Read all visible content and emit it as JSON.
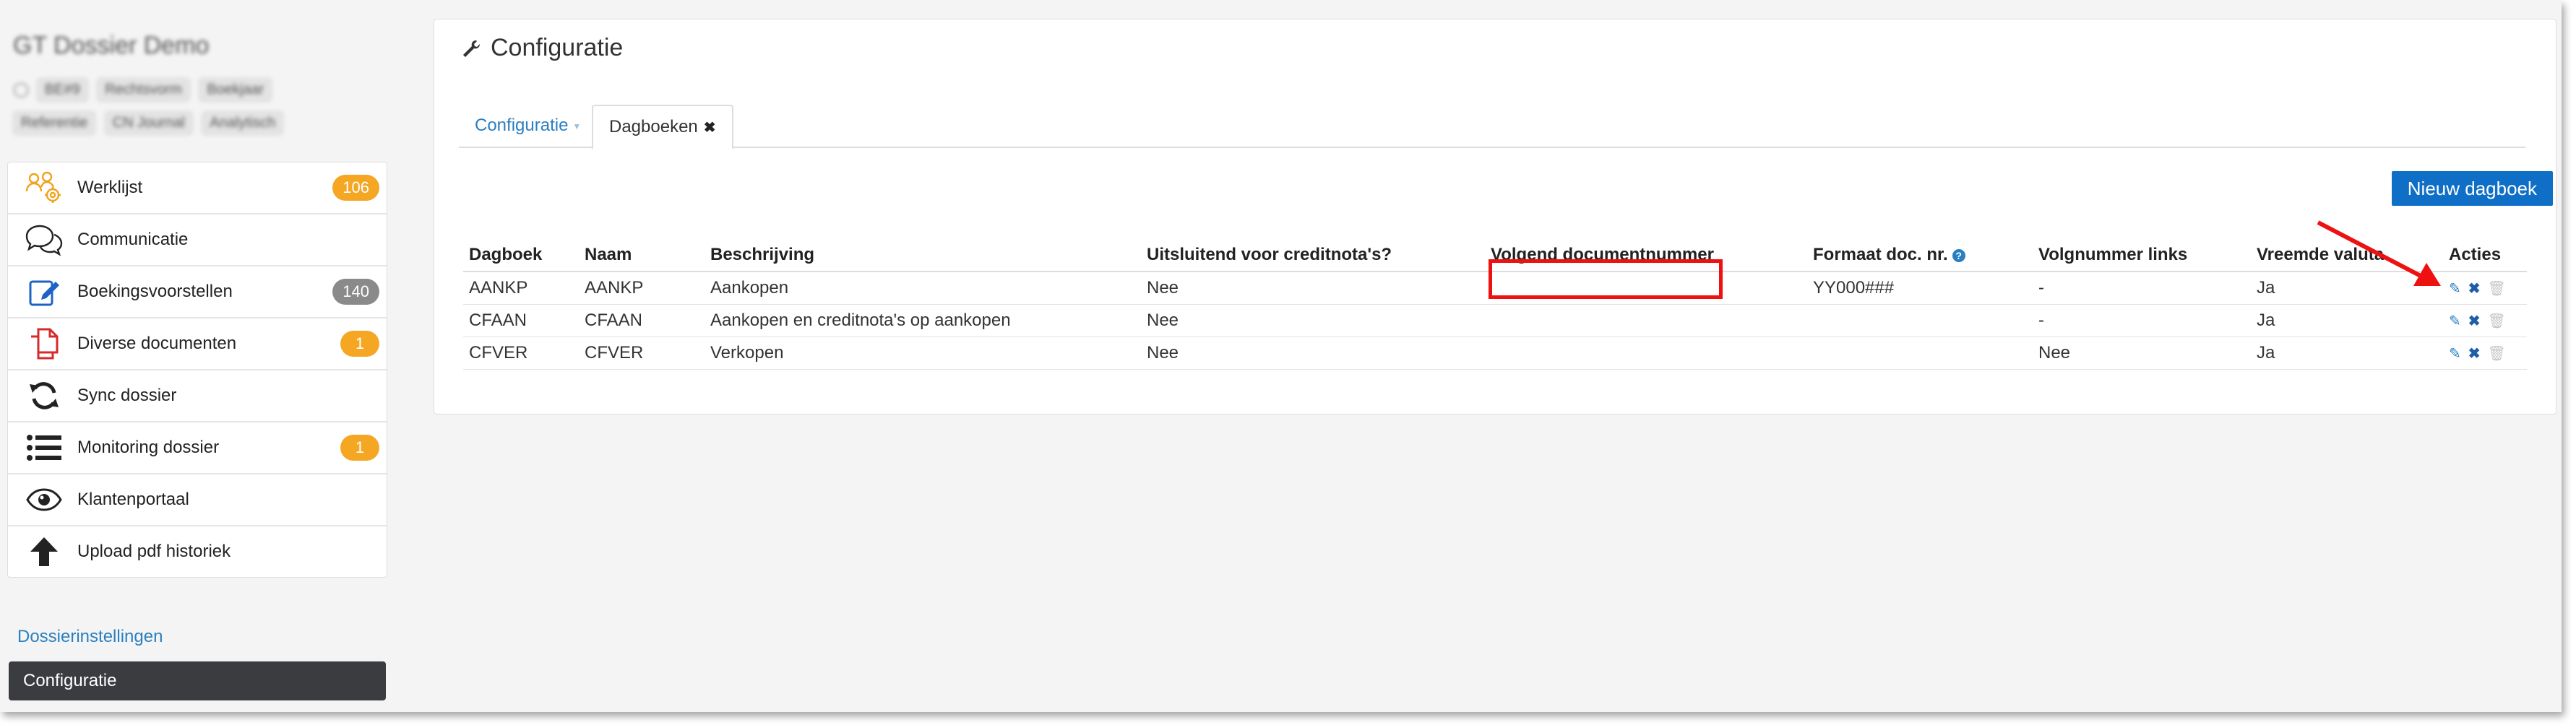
{
  "sidebar": {
    "dossier_title": "GT Dossier Demo",
    "tags_row1": [
      "BE#9",
      "Rechtsvorm",
      "Boekjaar"
    ],
    "tags_row2": [
      "Referentie",
      "CN Journal",
      "Analytisch"
    ],
    "menu": [
      {
        "label": "Werklijst",
        "icon": "users-cog-icon",
        "badge": "106",
        "badge_color": "#f5a623"
      },
      {
        "label": "Communicatie",
        "icon": "chat-bubbles-icon",
        "badge": null
      },
      {
        "label": "Boekingsvoorstellen",
        "icon": "edit-square-icon",
        "badge": "140",
        "badge_color": "#8a8a8a"
      },
      {
        "label": "Diverse documenten",
        "icon": "documents-icon",
        "badge": "1",
        "badge_color": "#f5a623"
      },
      {
        "label": "Sync dossier",
        "icon": "sync-icon",
        "badge": null
      },
      {
        "label": "Monitoring dossier",
        "icon": "list-icon",
        "badge": "1",
        "badge_color": "#f5a623"
      },
      {
        "label": "Klantenportaal",
        "icon": "eye-icon",
        "badge": null
      },
      {
        "label": "Upload pdf historiek",
        "icon": "arrow-up-icon",
        "badge": null
      }
    ],
    "settings_link": "Dossierinstellingen",
    "active_item": "Configuratie"
  },
  "panel": {
    "title": "Configuratie",
    "tabs": [
      {
        "label": "Configuratie"
      },
      {
        "label": "Dagboeken"
      }
    ],
    "new_button": "Nieuw dagboek",
    "columns": [
      "Dagboek",
      "Naam",
      "Beschrijving",
      "Uitsluitend voor creditnota's?",
      "Volgend documentnummer",
      "Formaat doc. nr.",
      "Volgnummer links",
      "Vreemde valuta",
      "Acties"
    ],
    "rows": [
      [
        "AANKP",
        "AANKP",
        "Aankopen",
        "Nee",
        "",
        "YY000###",
        "-",
        "Ja"
      ],
      [
        "CFAAN",
        "CFAAN",
        "Aankopen en creditnota's op aankopen",
        "Nee",
        "",
        "",
        "-",
        "Ja"
      ],
      [
        "CFVER",
        "CFVER",
        "Verkopen",
        "Nee",
        "",
        "",
        "Nee",
        "Ja"
      ]
    ]
  },
  "colors": {
    "accent": "#2a7fc1",
    "button": "#0f6fc6",
    "annotation": "#e11"
  }
}
